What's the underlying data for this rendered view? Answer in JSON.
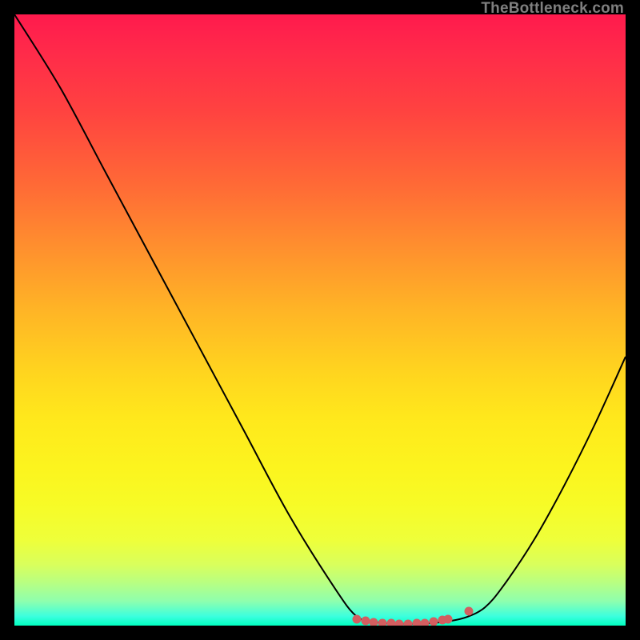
{
  "watermark_text": "TheBottleneck.com",
  "colors": {
    "frame": "#000000",
    "curve": "#000000",
    "marker": "#d35e60",
    "watermark": "#7f7f7f",
    "gradient_top": "#ff1a4d",
    "gradient_bottom": "#00ffc0"
  },
  "chart_data": {
    "type": "line",
    "title": "",
    "xlabel": "",
    "ylabel": "",
    "xlim": [
      0,
      100
    ],
    "ylim": [
      0,
      100
    ],
    "series": [
      {
        "name": "bottleneck-curve",
        "x": [
          0,
          7.5,
          15,
          22.5,
          30,
          37.5,
          45,
          52.5,
          56,
          59,
          62,
          65,
          68,
          71,
          74,
          77,
          80,
          85,
          90,
          95,
          100
        ],
        "y": [
          100,
          88,
          74,
          60,
          46,
          32,
          18,
          6,
          1.5,
          0.6,
          0.3,
          0.3,
          0.4,
          0.7,
          1.4,
          3.0,
          6.5,
          14,
          23,
          33,
          44
        ]
      }
    ],
    "markers": {
      "name": "highlight-dots",
      "x": [
        56.0,
        57.4,
        58.8,
        60.2,
        61.6,
        63.0,
        64.4,
        65.8,
        67.2,
        68.6,
        70.0,
        71.0,
        74.3
      ],
      "y": [
        1.05,
        0.72,
        0.52,
        0.4,
        0.33,
        0.31,
        0.32,
        0.36,
        0.45,
        0.63,
        0.9,
        1.05,
        2.4
      ]
    }
  }
}
